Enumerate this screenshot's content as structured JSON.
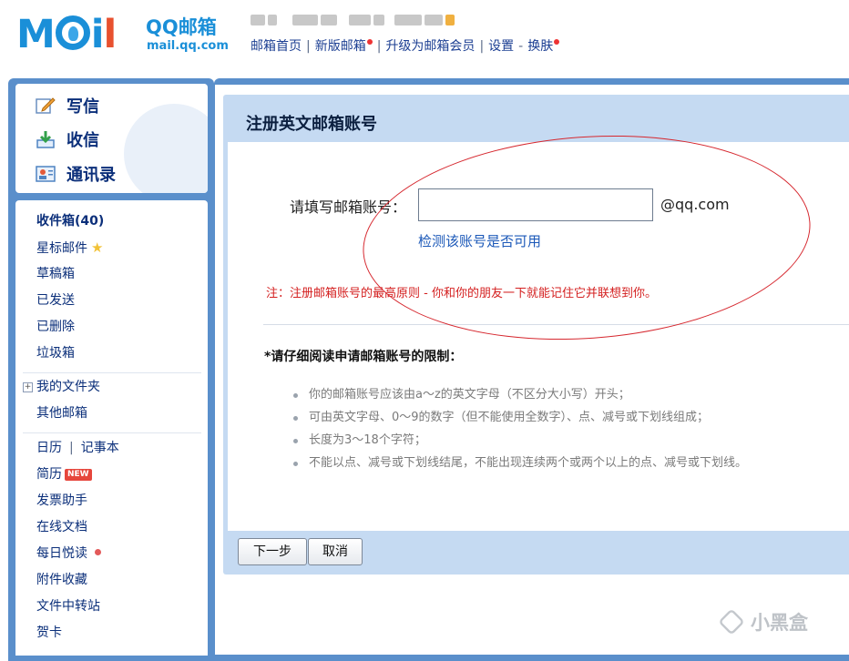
{
  "header": {
    "logo_mail": "MAIL",
    "logo_qq": "QQ邮箱",
    "logo_domain": "mail.qq.com",
    "links": {
      "home": "邮箱首页",
      "new_version": "新版邮箱",
      "upgrade": "升级为邮箱会员",
      "settings": "设置",
      "skin": "换肤"
    },
    "separator": "|",
    "dash": "-"
  },
  "sidebar": {
    "actions": {
      "compose": "写信",
      "receive": "收信",
      "contacts": "通讯录"
    },
    "folders": {
      "inbox": "收件箱(40)",
      "starred": "星标邮件",
      "drafts": "草稿箱",
      "sent": "已发送",
      "deleted": "已删除",
      "spam": "垃圾箱",
      "my_folders": "我的文件夹",
      "other_mail": "其他邮箱",
      "calendar": "日历",
      "notes": "记事本",
      "resume": "简历",
      "new_badge": "NEW",
      "invoice": "发票助手",
      "online_docs": "在线文档",
      "daily_read": "每日悦读",
      "attachments": "附件收藏",
      "transfer": "文件中转站",
      "cards": "贺卡"
    }
  },
  "form": {
    "title": "注册英文邮箱账号",
    "label": "请填写邮箱账号：",
    "input_value": "",
    "suffix": "@qq.com",
    "check_link": "检测该账号是否可用",
    "note": "注：注册邮箱账号的最高原则 - 你和你的朋友一下就能记住它并联想到你。",
    "rules_title": "*请仔细阅读申请邮箱账号的限制：",
    "rules": [
      "你的邮箱账号应该由a～z的英文字母（不区分大小写）开头；",
      "可由英文字母、0～9的数字（但不能使用全数字）、点、减号或下划线组成；",
      "长度为3～18个字符；",
      "不能以点、减号或下划线结尾，不能出现连续两个或两个以上的点、减号或下划线。"
    ],
    "buttons": {
      "next": "下一步",
      "cancel": "取消"
    }
  },
  "watermark": "小黑盒",
  "colors": {
    "frame_blue": "#5a8fcb",
    "link_blue": "#1b3e92",
    "note_red": "#d42020",
    "annotation_red": "#d6282f"
  }
}
